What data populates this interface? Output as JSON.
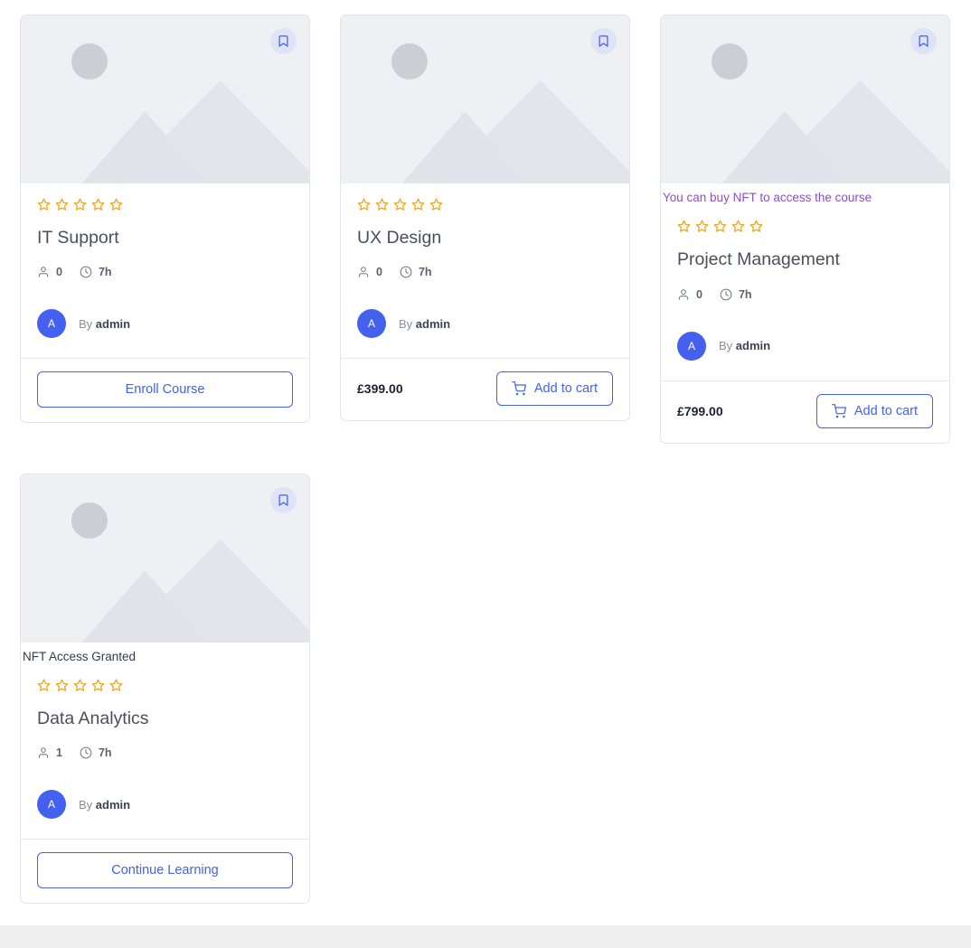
{
  "theme": {
    "accent": "#4361ee",
    "star": "#f0a217",
    "nft_note": "#8b4fc4",
    "granted_text": "#36394a",
    "card_border": "#e3e5ea",
    "placeholder_bg": "#eff0f4",
    "placeholder_shape": "#e1e3e9",
    "bookmark_bg": "#dfe3f7",
    "footer_strip": "#eeeeee"
  },
  "icons": {
    "bookmark": "bookmark-icon",
    "star": "star-outline-icon",
    "students": "person-icon",
    "duration": "clock-icon",
    "cart": "shopping-cart-icon"
  },
  "labels": {
    "by_prefix": "By",
    "enroll": "Enroll Course",
    "add_to_cart": "Add to cart",
    "continue_learning": "Continue Learning"
  },
  "cards": [
    {
      "id": "it-support",
      "badge": "",
      "badge_type": "none",
      "rating": 0,
      "rating_max": 5,
      "title": "IT Support",
      "students": "0",
      "duration": "7h",
      "author_initial": "A",
      "author_name": "admin",
      "action_type": "enroll",
      "action_label": "Enroll Course",
      "price": ""
    },
    {
      "id": "ux-design",
      "badge": "",
      "badge_type": "none",
      "rating": 0,
      "rating_max": 5,
      "title": "UX Design",
      "students": "0",
      "duration": "7h",
      "author_initial": "A",
      "author_name": "admin",
      "action_type": "cart",
      "action_label": "Add to cart",
      "price": "£399.00"
    },
    {
      "id": "project-management",
      "badge": "You can buy NFT to access the course",
      "badge_type": "nft-offer",
      "rating": 0,
      "rating_max": 5,
      "title": "Project Management",
      "students": "0",
      "duration": "7h",
      "author_initial": "A",
      "author_name": "admin",
      "action_type": "cart",
      "action_label": "Add to cart",
      "price": "£799.00"
    },
    {
      "id": "data-analytics",
      "badge": "NFT Access Granted",
      "badge_type": "nft-granted",
      "rating": 0,
      "rating_max": 5,
      "title": "Data Analytics",
      "students": "1",
      "duration": "7h",
      "author_initial": "A",
      "author_name": "admin",
      "action_type": "continue",
      "action_label": "Continue Learning",
      "price": ""
    }
  ]
}
